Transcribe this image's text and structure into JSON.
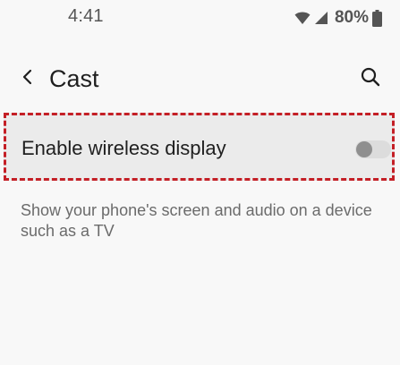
{
  "status_bar": {
    "time": "4:41",
    "battery_percent": "80%",
    "icons": [
      "wifi-icon",
      "cellular-signal-icon",
      "battery-icon"
    ]
  },
  "header": {
    "title": "Cast",
    "back_icon": "chevron-left-icon",
    "search_icon": "search-icon"
  },
  "setting": {
    "label": "Enable wireless display",
    "enabled": false
  },
  "description": "Show your phone's screen and audio on a device such as a TV",
  "colors": {
    "background": "#f8f8f8",
    "row_highlight": "#ebebeb",
    "highlight_border": "#c41f26",
    "toggle_track": "#dcdcdc",
    "toggle_thumb": "#8f8f8f",
    "secondary_text": "#6b6b6b"
  }
}
